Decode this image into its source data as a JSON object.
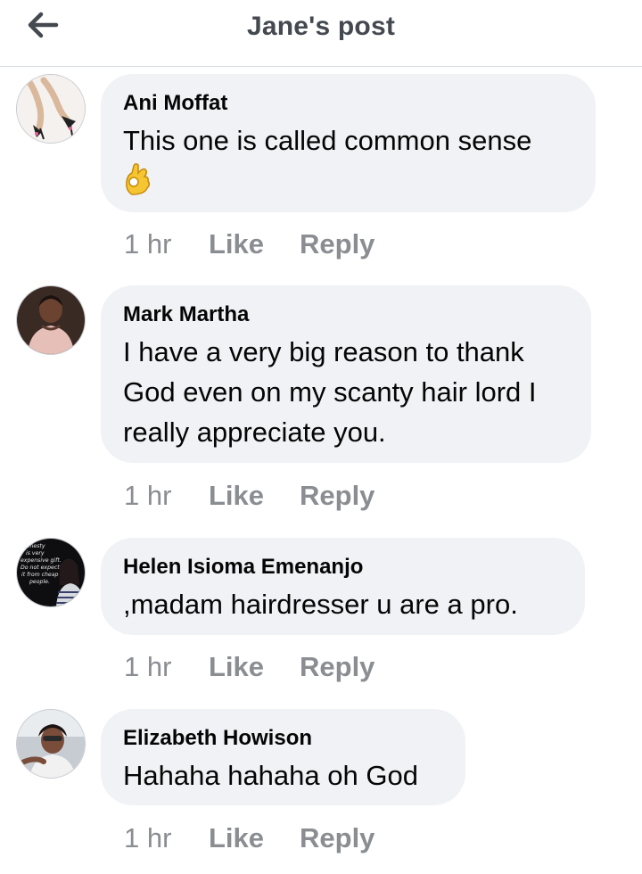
{
  "header": {
    "title": "Jane's post",
    "back_icon": "arrow-left-icon"
  },
  "colors": {
    "bubble": "#f0f2f5",
    "meta_text": "#8a8d91",
    "header_title": "#444950"
  },
  "comments": [
    {
      "author": "Ani Moffat",
      "text": "This one is called common sense",
      "emoji": "ok-hand-emoji",
      "time": "1 hr",
      "like_label": "Like",
      "reply_label": "Reply"
    },
    {
      "author": "Mark Martha",
      "text_lines": [
        "I have a very big reason to thank",
        "God even on my scanty hair lord I",
        "really appreciate you."
      ],
      "time": "1 hr",
      "like_label": "Like",
      "reply_label": "Reply"
    },
    {
      "author": "Helen Isioma Emenanjo",
      "text": ",madam hairdresser u are a pro.",
      "avatar_text": [
        "Honesty",
        "is very",
        "expensive gift.",
        "Do not expect",
        "it from cheap",
        "people."
      ],
      "time": "1 hr",
      "like_label": "Like",
      "reply_label": "Reply"
    },
    {
      "author": "Elizabeth Howison",
      "text": "Hahaha hahaha oh God",
      "time": "1 hr",
      "like_label": "Like",
      "reply_label": "Reply"
    }
  ]
}
